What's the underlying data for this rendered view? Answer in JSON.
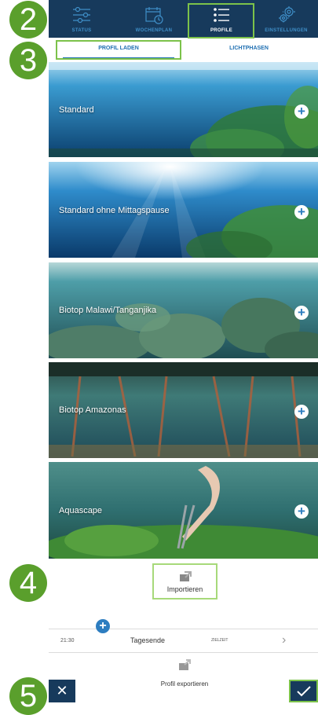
{
  "markers": [
    "2",
    "3",
    "4",
    "5"
  ],
  "nav": {
    "tabs": [
      {
        "label": "STATUS",
        "icon": "sliders-icon",
        "active": false
      },
      {
        "label": "WOCHENPLAN",
        "icon": "calendar-clock-icon",
        "active": false
      },
      {
        "label": "PROFILE",
        "icon": "list-icon",
        "active": true
      },
      {
        "label": "EINSTELLUNGEN",
        "icon": "gears-icon",
        "active": false
      }
    ]
  },
  "subtabs": [
    {
      "label": "PROFIL LADEN",
      "active": true
    },
    {
      "label": "LICHTPHASEN",
      "active": false
    }
  ],
  "profiles": [
    {
      "name": "Standard"
    },
    {
      "name": "Standard ohne Mittagspause"
    },
    {
      "name": "Biotop Malawi/Tanganjika"
    },
    {
      "name": "Biotop Amazonas"
    },
    {
      "name": "Aquascape"
    }
  ],
  "import": {
    "label": "Importieren",
    "icon": "import-icon"
  },
  "timeline": {
    "time": "21:30",
    "label": "Tagesende",
    "tag": "ZIELZEIT"
  },
  "export": {
    "label": "Profil exportieren",
    "icon": "export-icon"
  },
  "colors": {
    "nav_bg": "#173a5c",
    "accent": "#1f6fb2",
    "highlight": "#7cc24a",
    "marker": "#5a9f2c"
  }
}
